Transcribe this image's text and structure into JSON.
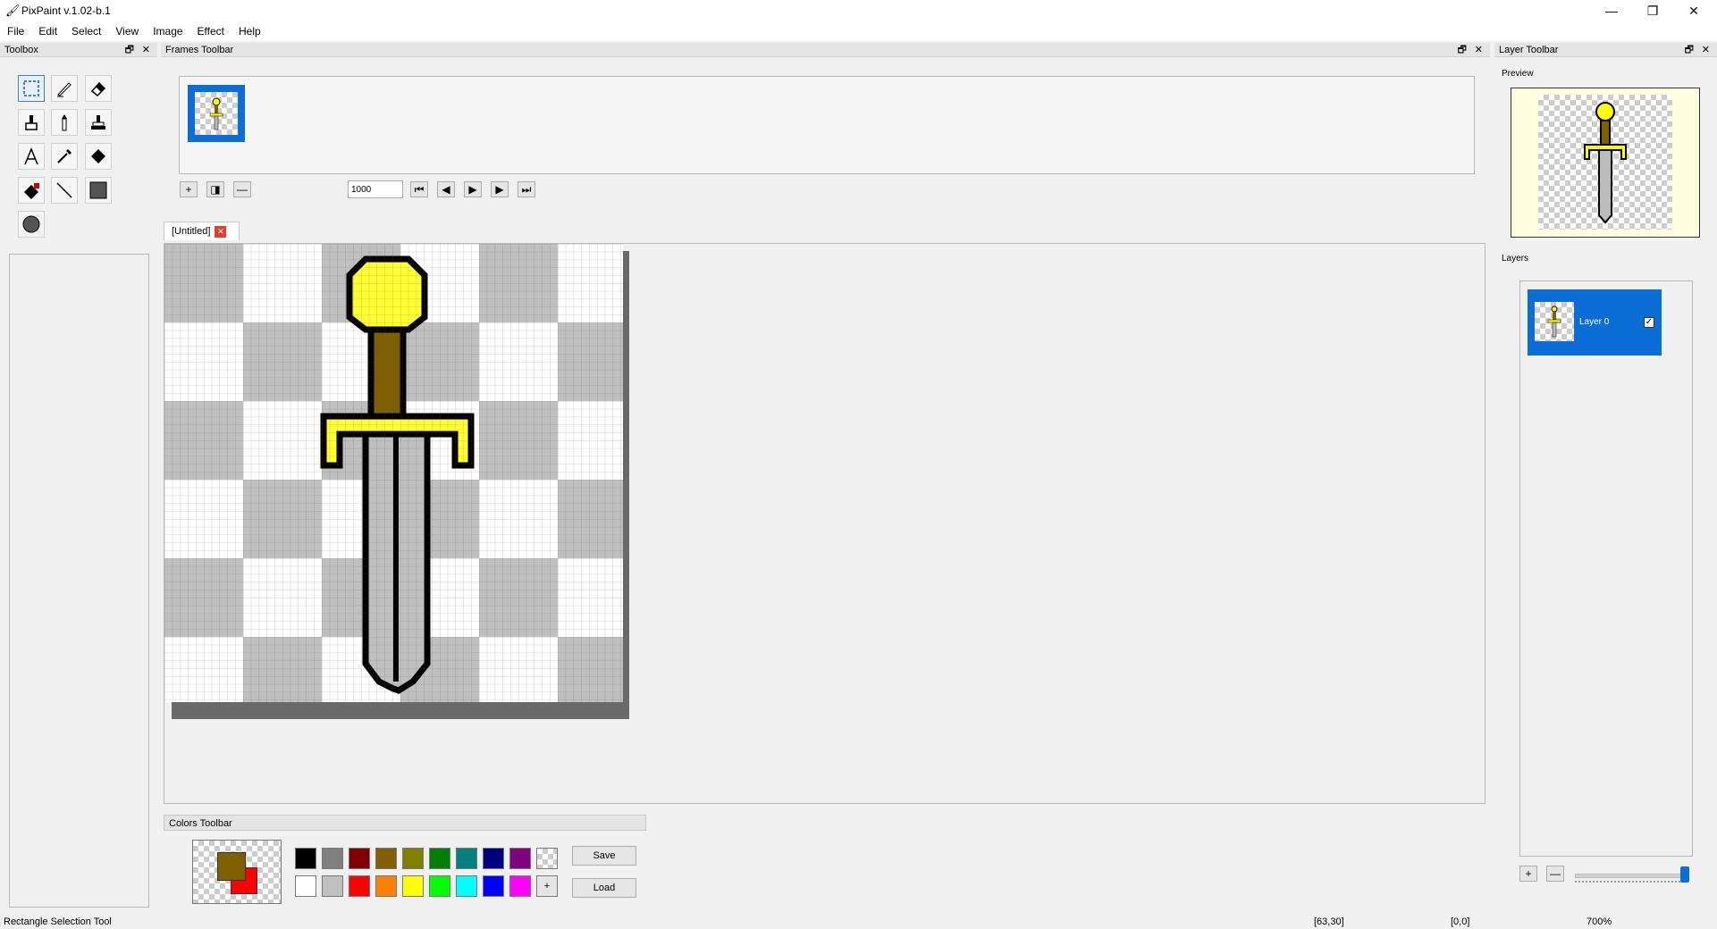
{
  "window": {
    "title": "PixPaint v.1.02-b.1",
    "minimize": "—",
    "maximize": "❐",
    "close": "✕"
  },
  "menu": [
    "File",
    "Edit",
    "Select",
    "View",
    "Image",
    "Effect",
    "Help"
  ],
  "toolbox": {
    "title": "Toolbox",
    "float": "🗗",
    "close": "✕"
  },
  "frames": {
    "title": "Frames Toolbar",
    "float": "🗗",
    "close": "✕",
    "interval": "1000",
    "buttons": {
      "add": "+",
      "duplicate": "◨",
      "remove": "—",
      "first": "⏮",
      "prev": "◀",
      "play": "▶",
      "next": "▶",
      "last": "⏭"
    }
  },
  "document": {
    "tab": "[Untitled]",
    "tab_close": "✕"
  },
  "layer_toolbar": {
    "title": "Layer Toolbar",
    "float": "🗗",
    "close": "✕",
    "preview_label": "Preview",
    "layers_label": "Layers",
    "layers": [
      {
        "name": "Layer 0",
        "visible": true
      }
    ],
    "add": "+",
    "remove": "—",
    "opacity": 1.0
  },
  "colors": {
    "title": "Colors Toolbar",
    "primary": "#7f6000",
    "secondary": "#ff0000",
    "row1": [
      "#000000",
      "#808080",
      "#800000",
      "#806000",
      "#808000",
      "#008000",
      "#008080",
      "#000080",
      "#800080",
      "transparent"
    ],
    "row2": [
      "#ffffff",
      "#c0c0c0",
      "#ff0000",
      "#ff8000",
      "#ffff00",
      "#00ff00",
      "#00ffff",
      "#0000ff",
      "#ff00ff",
      "add"
    ],
    "add_label": "+",
    "save": "Save",
    "load": "Load"
  },
  "status": {
    "tool": "Rectangle Selection Tool",
    "cursor": "[63,30]",
    "selection": "[0,0]",
    "zoom": "700%"
  }
}
